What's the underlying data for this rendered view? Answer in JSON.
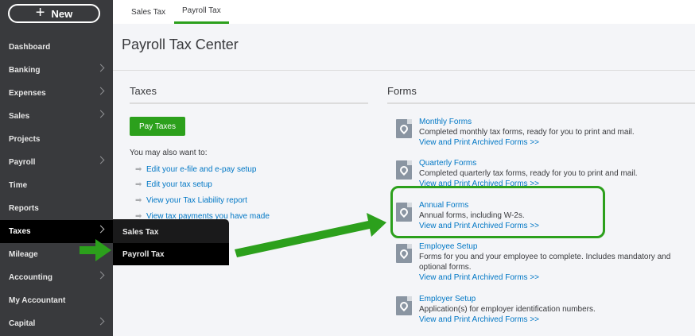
{
  "sidebar": {
    "new_label": "New",
    "items": [
      {
        "label": "Dashboard"
      },
      {
        "label": "Banking"
      },
      {
        "label": "Expenses"
      },
      {
        "label": "Sales"
      },
      {
        "label": "Projects"
      },
      {
        "label": "Payroll"
      },
      {
        "label": "Time"
      },
      {
        "label": "Reports"
      },
      {
        "label": "Taxes"
      },
      {
        "label": "Mileage"
      },
      {
        "label": "Accounting"
      },
      {
        "label": "My Accountant"
      },
      {
        "label": "Capital"
      }
    ]
  },
  "flyout": {
    "items": [
      {
        "label": "Sales Tax"
      },
      {
        "label": "Payroll Tax"
      }
    ]
  },
  "tabs": [
    {
      "label": "Sales Tax"
    },
    {
      "label": "Payroll Tax"
    }
  ],
  "page": {
    "title": "Payroll Tax Center"
  },
  "taxes": {
    "title": "Taxes",
    "pay_button": "Pay Taxes",
    "hint": "You may also want to:",
    "links": [
      {
        "label": "Edit your e-file and e-pay setup"
      },
      {
        "label": "Edit your tax setup"
      },
      {
        "label": "View your Tax Liability report"
      },
      {
        "label": "View tax payments you have made"
      }
    ]
  },
  "forms": {
    "title": "Forms",
    "archive_link": "View and Print Archived Forms >>",
    "items": [
      {
        "title": "Monthly Forms",
        "desc": "Completed monthly tax forms, ready for you to print and mail."
      },
      {
        "title": "Quarterly Forms",
        "desc": "Completed quarterly tax forms, ready for you to print and mail."
      },
      {
        "title": "Annual Forms",
        "desc": "Annual forms, including W-2s."
      },
      {
        "title": "Employee Setup",
        "desc": "Forms for you and your employee to complete. Includes mandatory and optional forms."
      },
      {
        "title": "Employer Setup",
        "desc": "Application(s) for employer identification numbers."
      }
    ]
  },
  "colors": {
    "accent": "#2ca01c",
    "link": "#0077c5",
    "sidebar": "#393a3d"
  }
}
